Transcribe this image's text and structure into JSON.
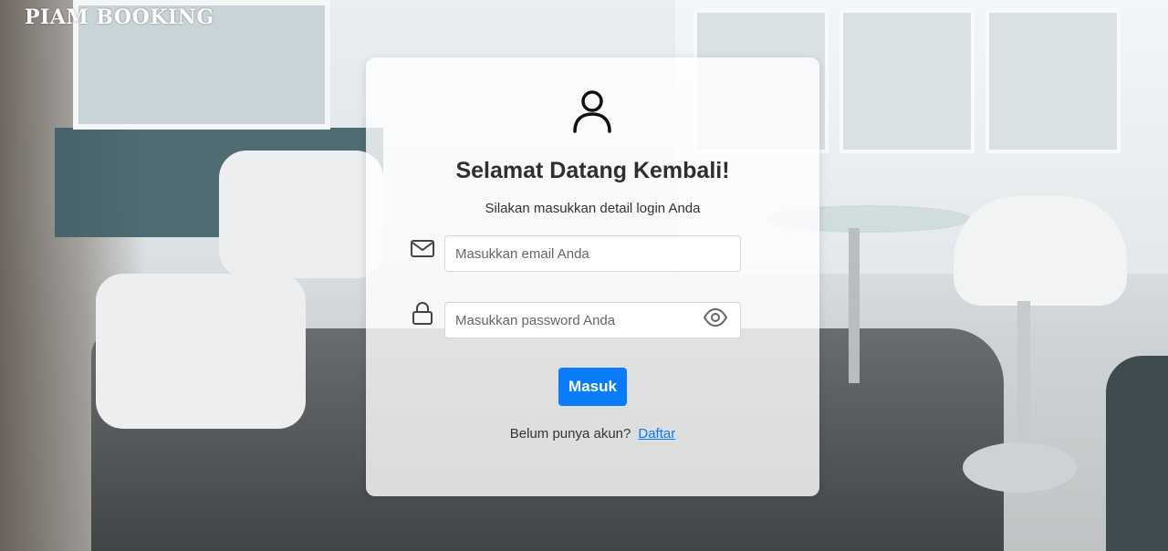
{
  "brand": {
    "name": "PIAM BOOKING"
  },
  "login": {
    "title": "Selamat Datang Kembali!",
    "subtitle": "Silakan masukkan detail login Anda",
    "email_placeholder": "Masukkan email Anda",
    "email_value": "",
    "password_placeholder": "Masukkan password Anda",
    "password_value": "",
    "submit_label": "Masuk",
    "signup_prompt": "Belum punya akun?",
    "signup_link": "Daftar"
  },
  "icons": {
    "user": "user-icon",
    "email": "envelope-icon",
    "password": "lock-icon",
    "toggle_password": "eye-icon"
  },
  "colors": {
    "accent": "#0a7bff",
    "text": "#2f2f2f"
  }
}
